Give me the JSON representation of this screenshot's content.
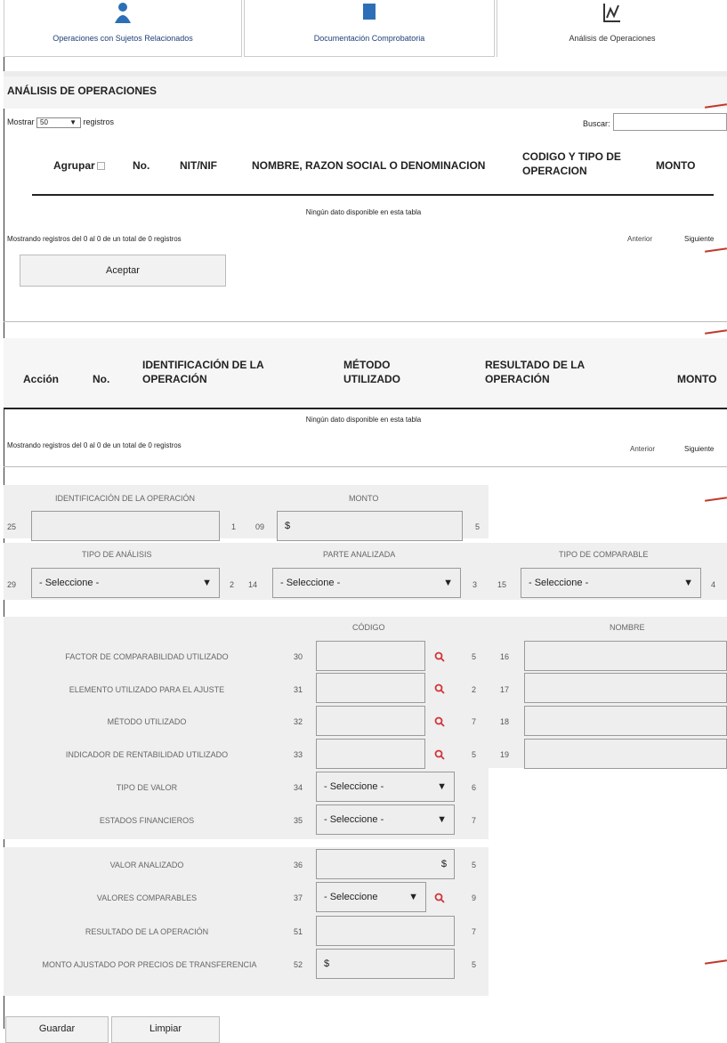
{
  "tabs": [
    {
      "label": "Operaciones con Sujetos Relacionados",
      "icon": "people-icon"
    },
    {
      "label": "Documentación Comprobatoria",
      "icon": "document-icon"
    },
    {
      "label": "Análisis de Operaciones",
      "icon": "chart-icon"
    }
  ],
  "section1": {
    "title": "ANÁLISIS DE OPERACIONES",
    "show_prefix": "Mostrar",
    "page_size": "50",
    "show_suffix": "registros",
    "search_label": "Buscar:",
    "columns": [
      "Agrupar",
      "No.",
      "NIT/NIF",
      "NOMBRE, RAZON SOCIAL O DENOMINACION",
      "CODIGO Y TIPO DE OPERACION",
      "MONTO"
    ],
    "empty_text": "Ningún dato disponible en esta tabla",
    "info": "Mostrando registros del 0 al 0 de un total de 0 registros",
    "prev": "Anterior",
    "next": "Siguiente",
    "accept": "Aceptar"
  },
  "section2": {
    "columns": [
      "Acción",
      "No.",
      "IDENTIFICACIÓN DE LA OPERACIÓN",
      "MÉTODO UTILIZADO",
      "RESULTADO DE LA OPERACIÓN",
      "MONTO"
    ],
    "empty_text": "Ningún dato disponible en esta tabla",
    "info": "Mostrando registros del 0 al 0 de un total de 0 registros",
    "prev": "Anterior",
    "next": "Siguiente"
  },
  "form": {
    "ident_label": "IDENTIFICACIÓN DE LA OPERACIÓN",
    "ident_num": "25",
    "ident_after": "1",
    "monto_label": "MONTO",
    "monto_num": "09",
    "monto_value": "$",
    "monto_after": "5",
    "tipo_analisis_label": "TIPO DE ANÁLISIS",
    "tipo_analisis_num": "29",
    "tipo_analisis_value": "- Seleccione -",
    "tipo_analisis_after": "2",
    "parte_label": "PARTE ANALIZADA",
    "parte_num": "14",
    "parte_value": "- Seleccione -",
    "parte_after": "3",
    "comparable_label": "TIPO DE COMPARABLE",
    "comparable_num": "15",
    "comparable_value": "- Seleccione -",
    "comparable_after": "4",
    "codigo_header": "CÓDIGO",
    "nombre_header": "NOMBRE",
    "rows": [
      {
        "label": "FACTOR DE COMPARABILIDAD UTILIZADO",
        "num": "30",
        "after": "5",
        "num2": "16"
      },
      {
        "label": "ELEMENTO UTILIZADO PARA EL AJUSTE",
        "num": "31",
        "after": "2",
        "num2": "17"
      },
      {
        "label": "MÉTODO UTILIZADO",
        "num": "32",
        "after": "7",
        "num2": "18"
      },
      {
        "label": "INDICADOR DE RENTABILIDAD UTILIZADO",
        "num": "33",
        "after": "5",
        "num2": "19"
      }
    ],
    "tipo_valor_label": "TIPO DE VALOR",
    "tipo_valor_num": "34",
    "tipo_valor_value": "- Seleccione -",
    "tipo_valor_after": "6",
    "estados_label": "ESTADOS FINANCIEROS",
    "estados_num": "35",
    "estados_value": "- Seleccione -",
    "estados_after": "7",
    "valor_analizado_label": "VALOR ANALIZADO",
    "valor_analizado_num": "36",
    "valor_analizado_value": "$",
    "valor_analizado_after": "5",
    "valores_comparables_label": "VALORES COMPARABLES",
    "valores_comparables_num": "37",
    "valores_comparables_value": "- Seleccione",
    "valores_comparables_after": "9",
    "resultado_label": "RESULTADO DE LA OPERACIÓN",
    "resultado_num": "51",
    "resultado_after": "7",
    "monto_ajustado_label": "MONTO AJUSTADO POR PRECIOS DE TRANSFERENCIA",
    "monto_ajustado_num": "52",
    "monto_ajustado_value": "$",
    "monto_ajustado_after": "5"
  },
  "actions": {
    "save": "Guardar",
    "clear": "Limpiar"
  },
  "colors": {
    "accent": "#1f3f7a",
    "panel": "#ececec",
    "search_icon": "#d0343a",
    "marker": "#c0392b"
  }
}
